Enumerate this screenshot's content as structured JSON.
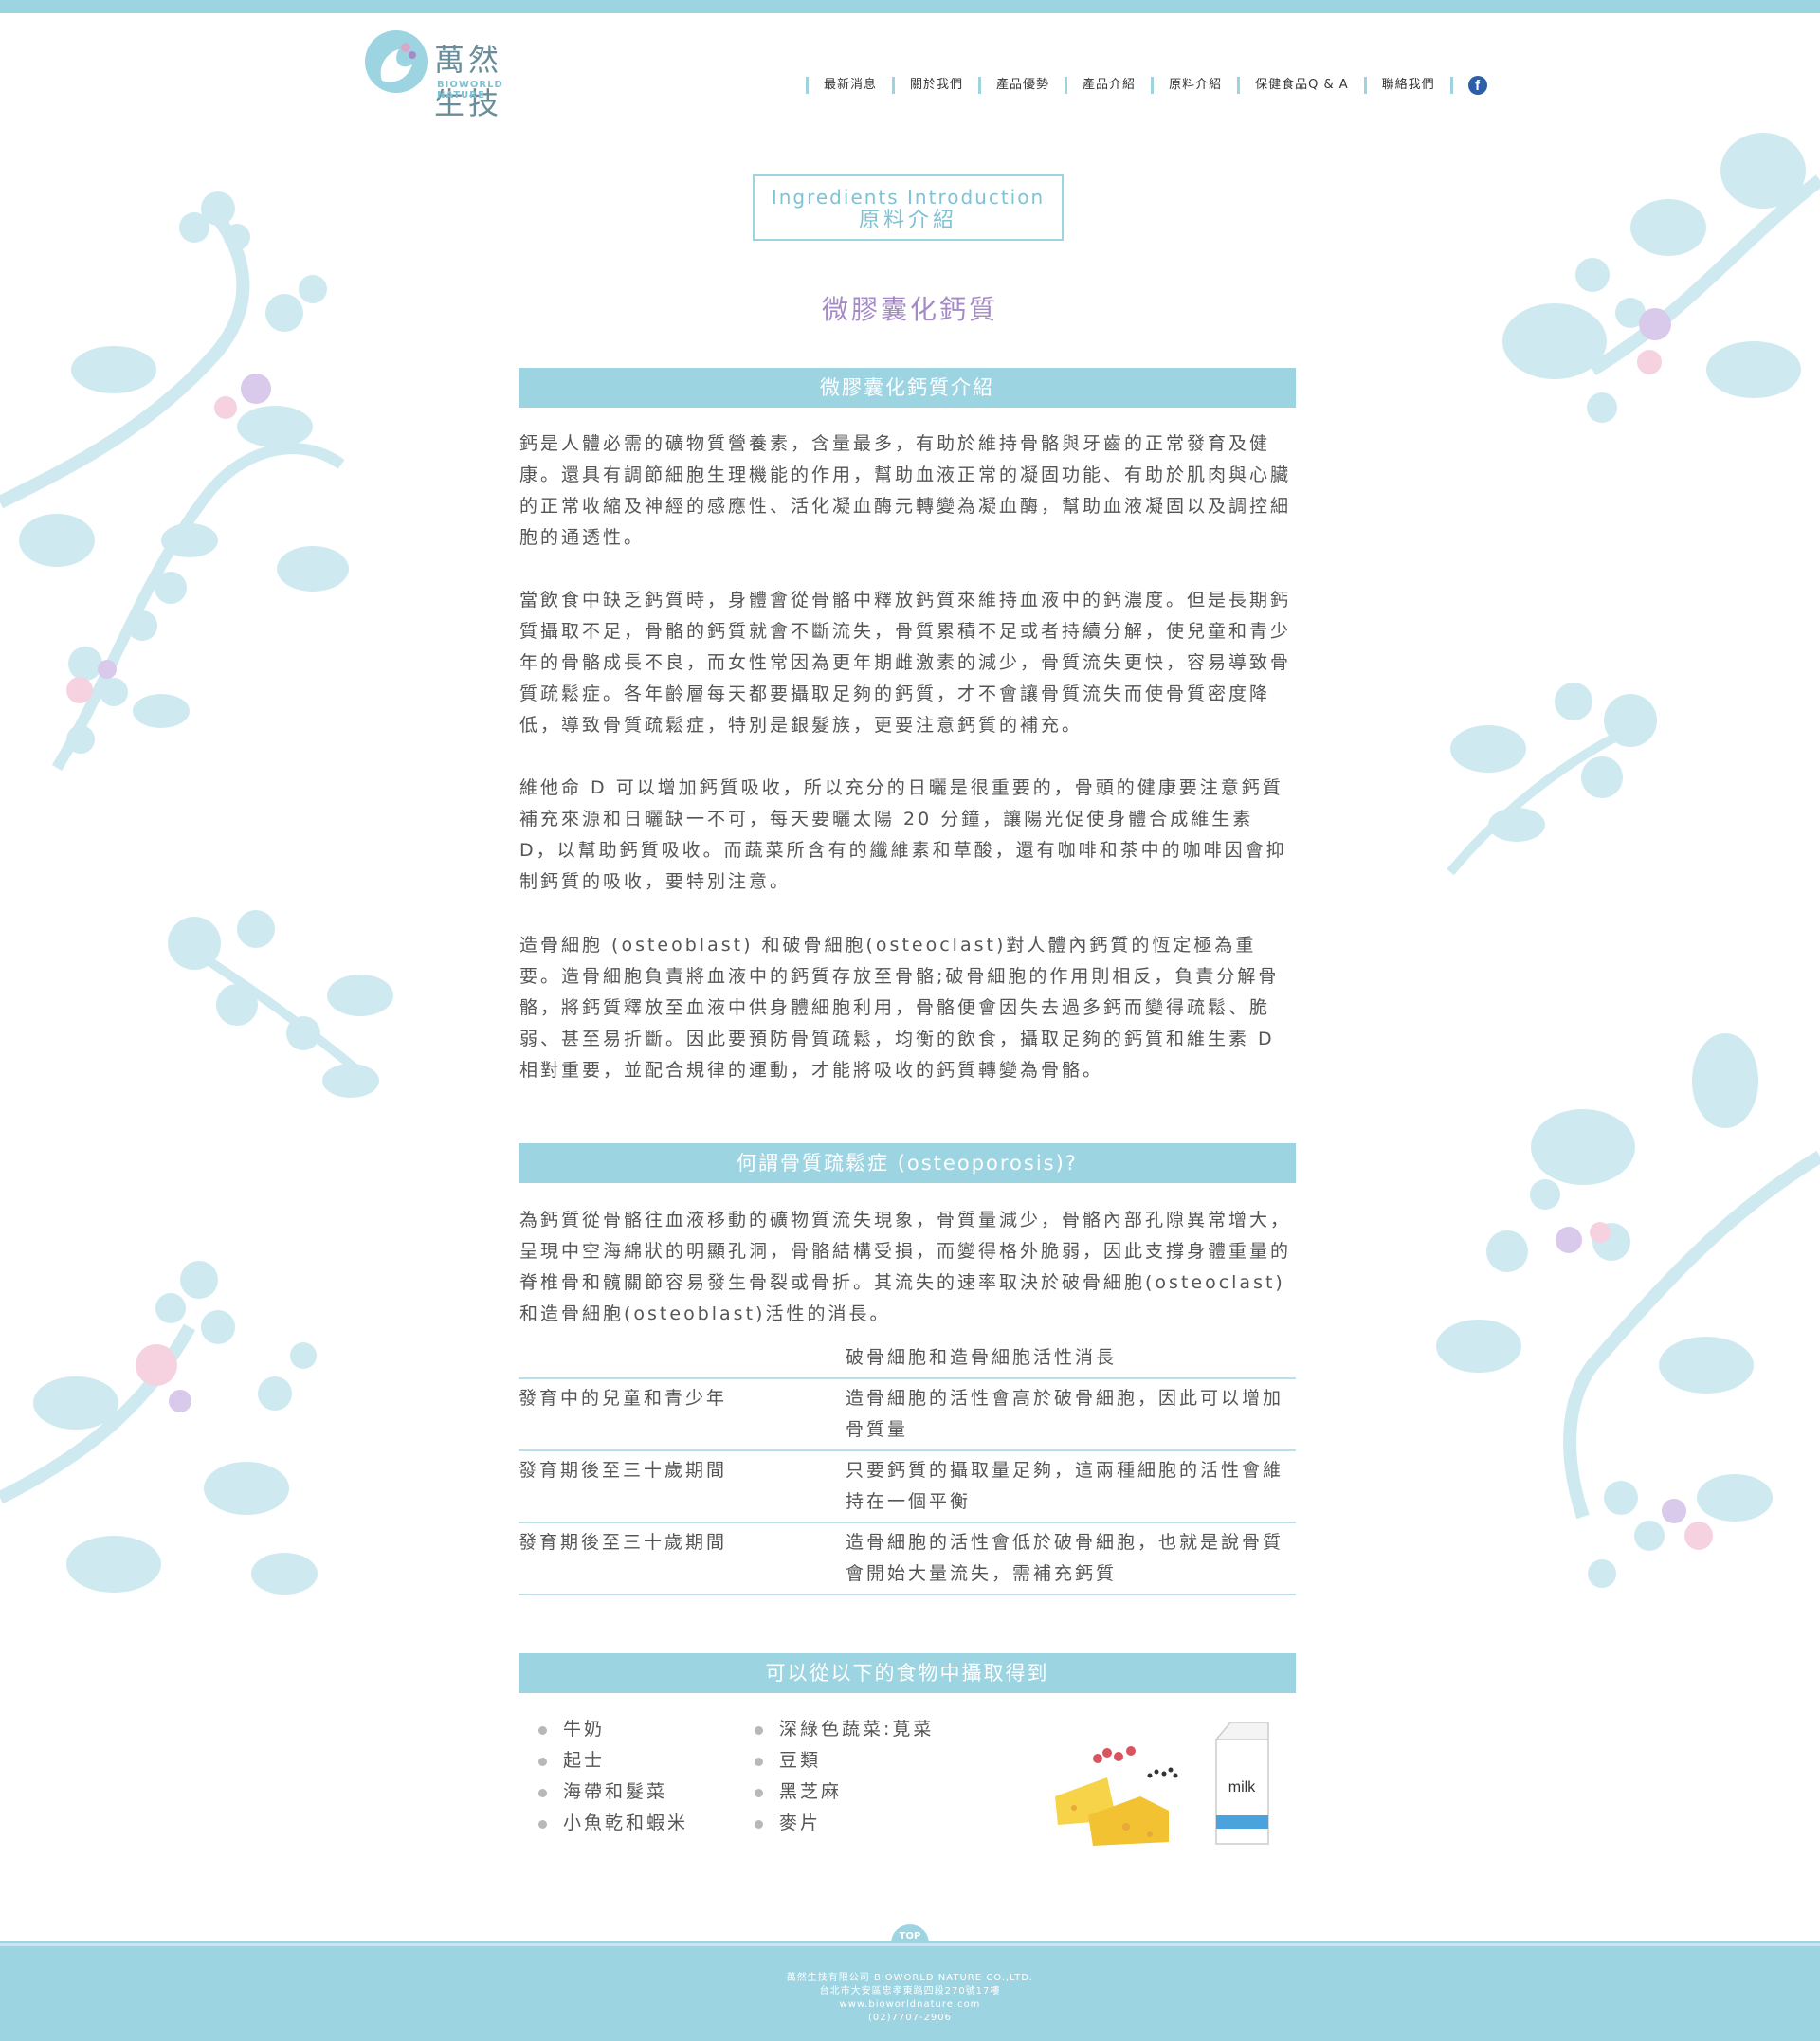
{
  "brand": {
    "name_cn": "萬然生技",
    "name_en": "BIOWORLD NATURE"
  },
  "nav": {
    "items": [
      "最新消息",
      "關於我們",
      "產品優勢",
      "產品介紹",
      "原料介紹",
      "保健食品Q & A",
      "聯絡我們"
    ],
    "facebook": "f"
  },
  "title": {
    "en": "Ingredients Introduction",
    "cn": "原料介紹"
  },
  "subtitle": "微膠囊化鈣質",
  "section1": {
    "heading": "微膠囊化鈣質介紹",
    "p1": "鈣是人體必需的礦物質營養素，含量最多，有助於維持骨骼與牙齒的正常發育及健康。還具有調節細胞生理機能的作用，幫助血液正常的凝固功能、有助於肌肉與心臟的正常收縮及神經的感應性、活化凝血酶元轉變為凝血酶，幫助血液凝固以及調控細胞的通透性。",
    "p2": "當飲食中缺乏鈣質時，身體會從骨骼中釋放鈣質來維持血液中的鈣濃度。但是長期鈣質攝取不足，骨骼的鈣質就會不斷流失，骨質累積不足或者持續分解，使兒童和青少年的骨骼成長不良，而女性常因為更年期雌激素的減少，骨質流失更快，容易導致骨質疏鬆症。各年齡層每天都要攝取足夠的鈣質，才不會讓骨質流失而使骨質密度降低，導致骨質疏鬆症，特別是銀髮族，更要注意鈣質的補充。",
    "p3": "維他命 D 可以增加鈣質吸收，所以充分的日曬是很重要的，骨頭的健康要注意鈣質補充來源和日曬缺一不可，每天要曬太陽 20 分鐘，讓陽光促使身體合成維生素 D，以幫助鈣質吸收。而蔬菜所含有的纖維素和草酸，還有咖啡和茶中的咖啡因會抑制鈣質的吸收，要特別注意。",
    "p4": "造骨細胞 (osteoblast) 和破骨細胞(osteoclast)對人體內鈣質的恆定極為重要。造骨細胞負責將血液中的鈣質存放至骨骼;破骨細胞的作用則相反，負責分解骨骼，將鈣質釋放至血液中供身體細胞利用，骨骼便會因失去過多鈣而變得疏鬆、脆弱、甚至易折斷。因此要預防骨質疏鬆，均衡的飲食，攝取足夠的鈣質和維生素 D 相對重要，並配合規律的運動，才能將吸收的鈣質轉變為骨骼。"
  },
  "section2": {
    "heading": "何謂骨質疏鬆症 (osteoporosis)?",
    "p1": "為鈣質從骨骼往血液移動的礦物質流失現象，骨質量減少，骨骼內部孔隙異常增大，呈現中空海綿狀的明顯孔洞，骨骼結構受損，而變得格外脆弱，因此支撐身體重量的脊椎骨和髖關節容易發生骨裂或骨折。其流失的速率取決於破骨細胞(osteoclast)和造骨細胞(osteoblast)活性的消長。",
    "table": {
      "header": [
        "",
        "破骨細胞和造骨細胞活性消長"
      ],
      "rows": [
        [
          "發育中的兒童和青少年",
          "造骨細胞的活性會高於破骨細胞，因此可以增加骨質量"
        ],
        [
          "發育期後至三十歲期間",
          "只要鈣質的攝取量足夠，這兩種細胞的活性會維持在一個平衡"
        ],
        [
          "發育期後至三十歲期間",
          "造骨細胞的活性會低於破骨細胞，也就是說骨質會開始大量流失，需補充鈣質"
        ]
      ]
    }
  },
  "section3": {
    "heading": "可以從以下的食物中攝取得到",
    "col1": [
      "牛奶",
      "起士",
      "海帶和髮菜",
      "小魚乾和蝦米"
    ],
    "col2": [
      "深綠色蔬菜:莧菜",
      "豆類",
      "黑芝麻",
      "麥片"
    ],
    "milk_label": "milk"
  },
  "top_button": "TOP",
  "footer": {
    "company": "萬然生技有限公司 BIOWORLD NATURE CO.,LTD.",
    "address": "台北市大安區忠孝東路四段270號17樓",
    "website": "www.bioworldnature.com",
    "phone": "(02)7707-2906"
  },
  "colors": {
    "accent": "#9dd4e2",
    "subtitle": "#a58bc5",
    "text": "#555555",
    "floral": "#cde9f1"
  }
}
